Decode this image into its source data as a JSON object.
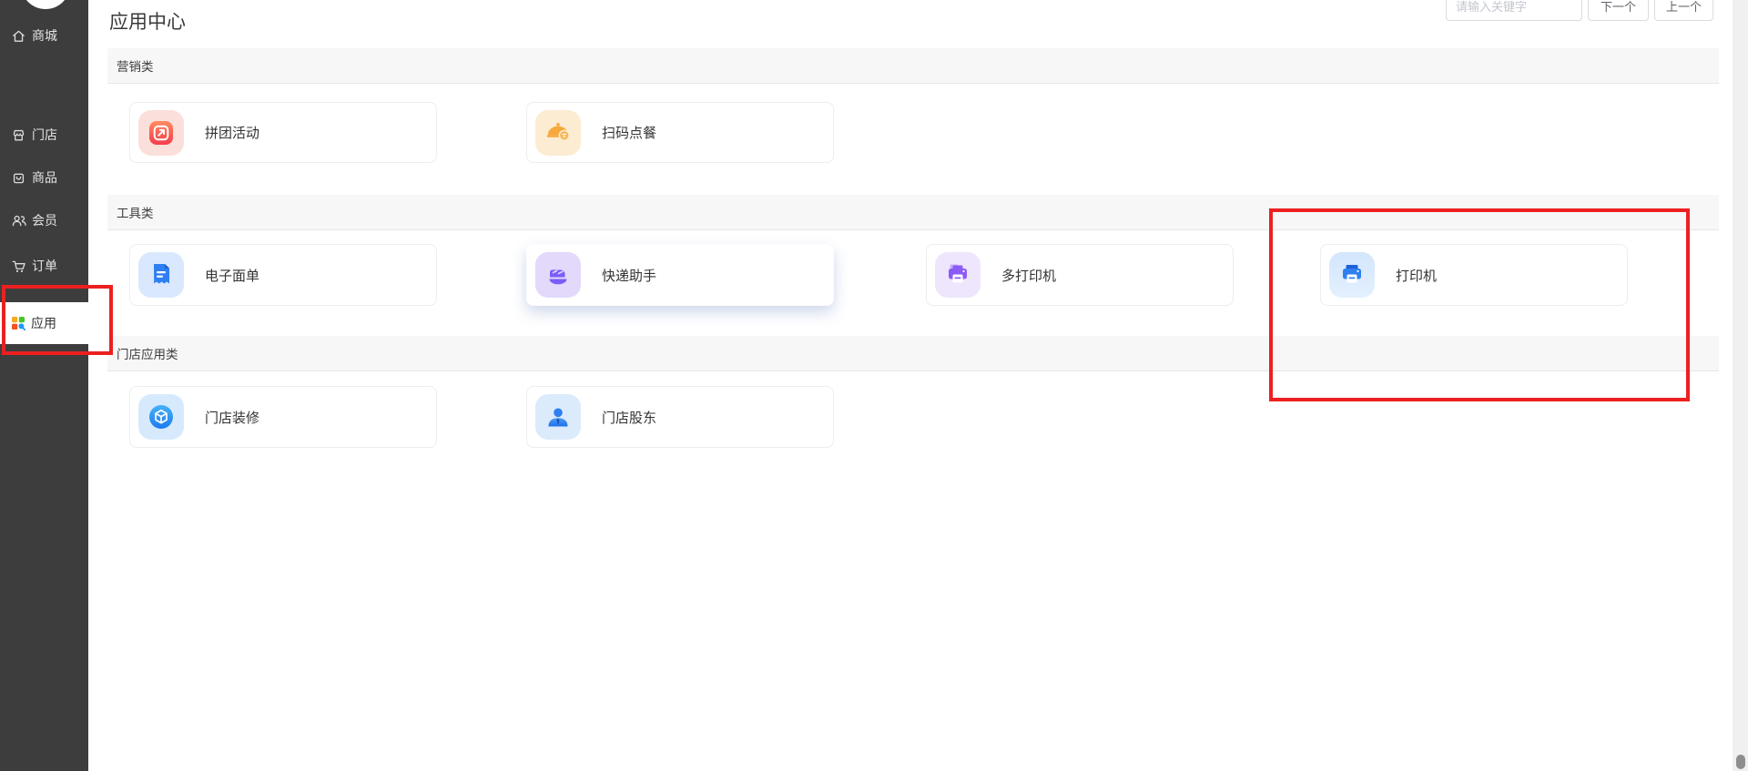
{
  "header": {
    "title": "应用中心",
    "search_placeholder": "请输入关键字",
    "next_label": "下一个",
    "prev_label": "上一个"
  },
  "sidebar": {
    "items": [
      {
        "label": "商城",
        "icon": "home-icon",
        "active": false
      },
      {
        "label": "门店",
        "icon": "storefront-icon",
        "active": false
      },
      {
        "label": "商品",
        "icon": "goods-icon",
        "active": false
      },
      {
        "label": "会员",
        "icon": "members-icon",
        "active": false
      },
      {
        "label": "订单",
        "icon": "orders-cart-icon",
        "active": false
      },
      {
        "label": "应用",
        "icon": "apps-grid-icon",
        "active": true
      }
    ]
  },
  "sections": [
    {
      "title": "营销类",
      "apps": [
        {
          "name": "拼团活动",
          "icon": "group-buy-icon",
          "accent": "#f5383f"
        },
        {
          "name": "扫码点餐",
          "icon": "scan-order-icon",
          "accent": "#f7a83c"
        }
      ]
    },
    {
      "title": "工具类",
      "apps": [
        {
          "name": "电子面单",
          "icon": "waybill-icon",
          "accent": "#2f7ff2"
        },
        {
          "name": "快递助手",
          "icon": "express-helper-icon",
          "accent": "#7c5cfa",
          "hovered": true
        },
        {
          "name": "多打印机",
          "icon": "multi-printer-icon",
          "accent": "#8b5cf6"
        },
        {
          "name": "打印机",
          "icon": "printer-icon",
          "accent": "#2f7ff2"
        }
      ]
    },
    {
      "title": "门店应用类",
      "apps": [
        {
          "name": "门店装修",
          "icon": "store-decoration-icon",
          "accent": "#2b8ef5"
        },
        {
          "name": "门店股东",
          "icon": "store-shareholder-icon",
          "accent": "#2f7ff2"
        }
      ]
    }
  ],
  "annotations": {
    "color": "#ec2020",
    "targets": [
      "sidebar-apps-item",
      "printer-card-region"
    ]
  },
  "colors": {
    "sidebar_bg": "#3d3d3d",
    "band_bg": "#f7f7f8",
    "card_border": "#ebedf0"
  }
}
